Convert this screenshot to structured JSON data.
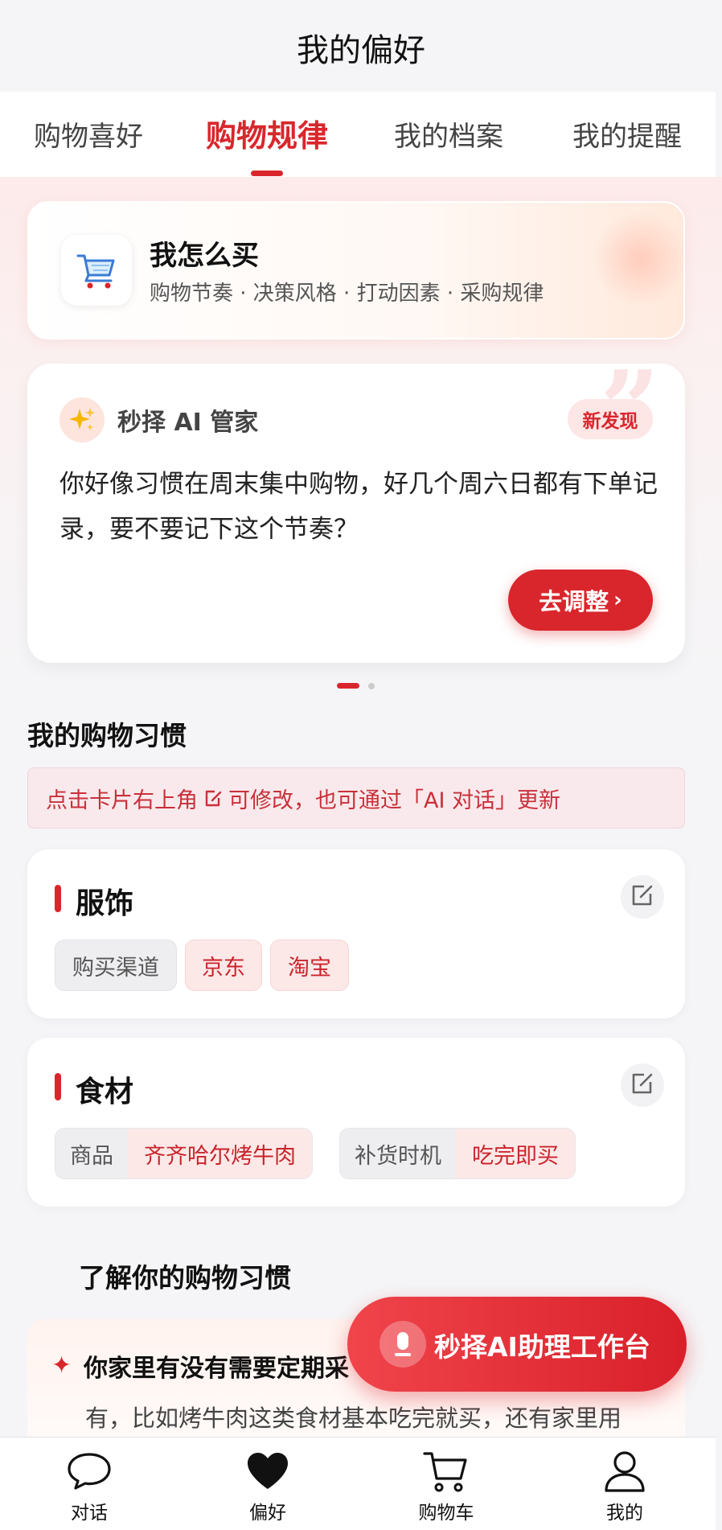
{
  "header": {
    "title": "我的偏好"
  },
  "tabs": [
    {
      "label": "购物喜好",
      "active": false
    },
    {
      "label": "购物规律",
      "active": true
    },
    {
      "label": "我的档案",
      "active": false
    },
    {
      "label": "我的提醒",
      "active": false
    }
  ],
  "how_i_buy": {
    "icon": "shopping-cart-icon",
    "title": "我怎么买",
    "subtitle": "购物节奏 · 决策风格 · 打动因素 · 采购规律"
  },
  "ai_card": {
    "icon": "sparkles-icon",
    "title": "秒择 AI 管家",
    "badge": "新发现",
    "message": "你好像习惯在周末集中购物，好几个周六日都有下单记录，要不要记下这个节奏？",
    "button": "去调整",
    "button_arrow": "›",
    "quote_mark": "”"
  },
  "section_title": "我的购物习惯",
  "hint": {
    "before": "点击卡片右上角",
    "after": "可修改，也可通过「AI 对话」更新"
  },
  "habits": [
    {
      "title": "服饰",
      "label": "购买渠道",
      "values": [
        "京东",
        "淘宝"
      ]
    },
    {
      "title": "食材",
      "pairs": [
        {
          "key": "商品",
          "value": "齐齐哈尔烤牛肉"
        },
        {
          "key": "补货时机",
          "value": "吃完即买"
        }
      ]
    }
  ],
  "learn": {
    "title": "了解你的购物习惯",
    "star": "✦",
    "question": "你家里有没有需要定期采",
    "answer": "有，比如烤牛肉这类食材基本吃完就买，还有家里用"
  },
  "float_button": {
    "label": "秒择AI助理工作台",
    "icon": "microphone-icon"
  },
  "colors": {
    "accent": "#d9262c",
    "chip_bg": "#fde8e8",
    "gray_chip": "#eeeef1"
  },
  "bottom_nav": [
    {
      "label": "对话",
      "icon": "chat-bubble-icon"
    },
    {
      "label": "偏好",
      "icon": "heart-icon"
    },
    {
      "label": "购物车",
      "icon": "cart-icon"
    },
    {
      "label": "我的",
      "icon": "person-icon"
    }
  ]
}
